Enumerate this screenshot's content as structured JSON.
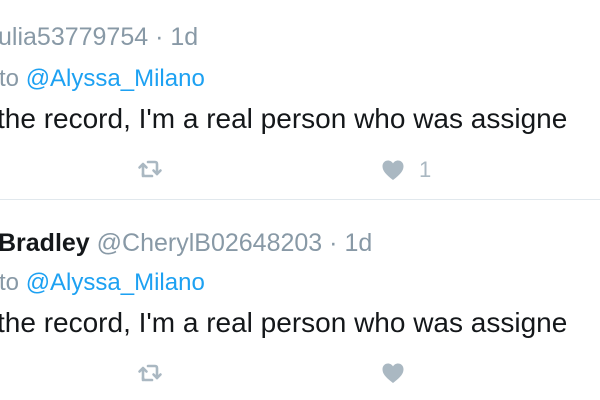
{
  "tweets": [
    {
      "display_name": "",
      "handle": "ulia53779754",
      "separator": "·",
      "time": "1d",
      "reply_prefix": "to",
      "reply_mention": "@Alyssa_Milano",
      "text": "the record, I'm a real person who was assigne",
      "like_count": "1"
    },
    {
      "display_name": "Bradley",
      "handle": "@CherylB02648203",
      "separator": "·",
      "time": "1d",
      "reply_prefix": "to",
      "reply_mention": "@Alyssa_Milano",
      "text": "the record, I'm a real person who was assigne",
      "like_count": ""
    }
  ],
  "icons": {
    "retweet": "retweet-icon",
    "like": "heart-icon"
  },
  "colors": {
    "text_primary": "#14171a",
    "text_secondary": "#8899a6",
    "mention": "#1da1f2",
    "action_icon": "#aab8c2",
    "divider": "#e1e8ed"
  }
}
